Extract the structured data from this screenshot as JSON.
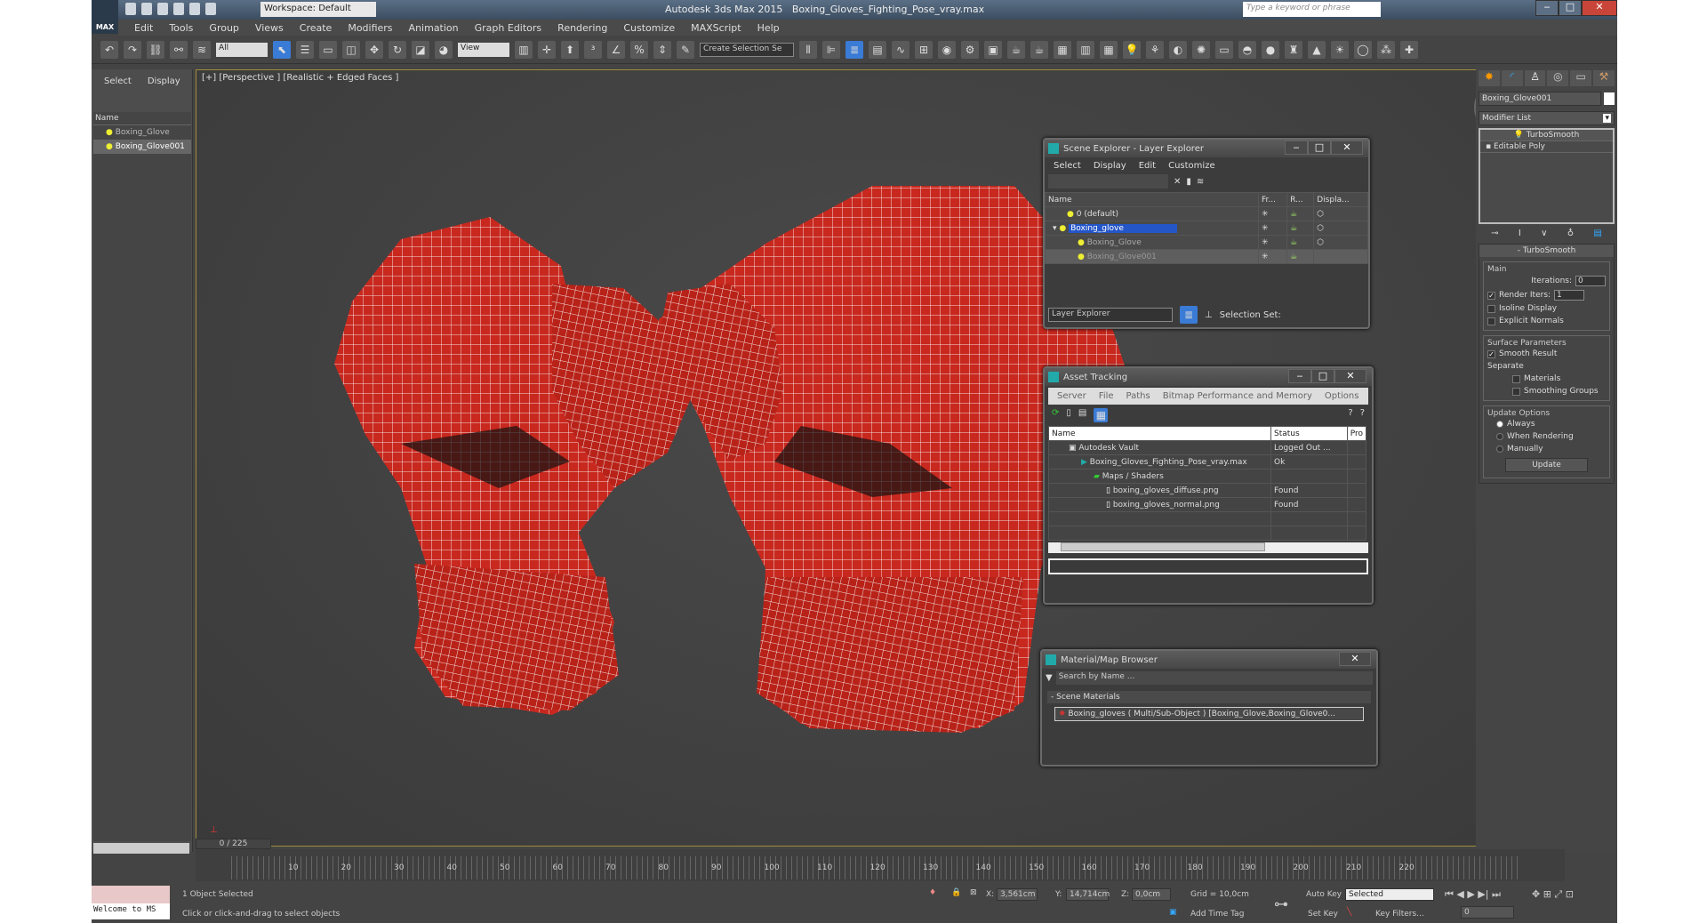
{
  "titlebar": {
    "app": "Autodesk 3ds Max 2015",
    "file": "Boxing_Gloves_Fighting_Pose_vray.max",
    "workspace": "Workspace: Default",
    "search_placeholder": "Type a keyword or phrase",
    "logo": "MAX"
  },
  "menu": [
    "Edit",
    "Tools",
    "Group",
    "Views",
    "Create",
    "Modifiers",
    "Animation",
    "Graph Editors",
    "Rendering",
    "Customize",
    "MAXScript",
    "Help"
  ],
  "toolbar": {
    "filter": "All",
    "ref_coord": "View",
    "selection_set": "Create Selection Se"
  },
  "left_panel": {
    "tabs": [
      "Select",
      "Display"
    ],
    "header": "Name",
    "items": [
      "Boxing_Glove",
      "Boxing_Glove001"
    ]
  },
  "viewport": {
    "label": "[+] [Perspective ] [Realistic + Edged Faces ]"
  },
  "scene_explorer": {
    "title": "Scene Explorer - Layer Explorer",
    "menu": [
      "Select",
      "Display",
      "Edit",
      "Customize"
    ],
    "columns": [
      "Name",
      "Fr...",
      "R...",
      "Displa..."
    ],
    "rows": [
      "0 (default)",
      "Boxing_glove",
      "Boxing_Glove",
      "Boxing_Glove001"
    ],
    "footer_dropdown": "Layer Explorer",
    "selection_set": "Selection Set:"
  },
  "asset_tracking": {
    "title": "Asset Tracking",
    "menu": [
      "Server",
      "File",
      "Paths",
      "Bitmap Performance and Memory",
      "Options"
    ],
    "columns": [
      "Name",
      "Status",
      "Pro"
    ],
    "rows": [
      {
        "name": "Autodesk Vault",
        "status": "Logged Out ..."
      },
      {
        "name": "Boxing_Gloves_Fighting_Pose_vray.max",
        "status": "Ok"
      },
      {
        "name": "Maps / Shaders",
        "status": ""
      },
      {
        "name": "boxing_gloves_diffuse.png",
        "status": "Found"
      },
      {
        "name": "boxing_gloves_normal.png",
        "status": "Found"
      }
    ]
  },
  "material_browser": {
    "title": "Material/Map Browser",
    "search_placeholder": "Search by Name ...",
    "section": "- Scene Materials",
    "item": "Boxing_gloves ( Multi/Sub-Object ) [Boxing_Glove,Boxing_Glove0..."
  },
  "command_panel": {
    "object_name": "Boxing_Glove001",
    "modifier_list": "Modifier List",
    "stack": [
      "TurboSmooth",
      "Editable Poly"
    ],
    "rollout": "TurboSmooth",
    "main": "Main",
    "iterations_label": "Iterations:",
    "iterations": "0",
    "render_iters_label": "Render Iters:",
    "render_iters": "1",
    "isoline": "Isoline Display",
    "explicit": "Explicit Normals",
    "surface": "Surface Parameters",
    "smooth_result": "Smooth Result",
    "separate": "Separate",
    "materials": "Materials",
    "smoothing_groups": "Smoothing Groups",
    "update_options": "Update Options",
    "always": "Always",
    "when_rendering": "When Rendering",
    "manually": "Manually",
    "update": "Update"
  },
  "timeline": {
    "frame": "0 / 225",
    "ticks": [
      "10",
      "20",
      "30",
      "40",
      "50",
      "60",
      "70",
      "80",
      "90",
      "100",
      "110",
      "120",
      "130",
      "140",
      "150",
      "160",
      "170",
      "180",
      "190",
      "200",
      "210",
      "220"
    ]
  },
  "status": {
    "selected": "1 Object Selected",
    "prompt": "Click or click-and-drag to select objects",
    "welcome": "Welcome to MS",
    "x": "3,561cm",
    "y": "14,714cm",
    "z": "0,0cm",
    "grid": "Grid = 10,0cm",
    "auto_key": "Auto Key",
    "set_key": "Set Key",
    "key_mode": "Selected",
    "key_filters": "Key Filters...",
    "add_time_tag": "Add Time Tag",
    "current_frame": "0"
  },
  "colors": {
    "accent": "#3a7bd5",
    "glove": "#c8281e",
    "wire": "#ffffff"
  }
}
